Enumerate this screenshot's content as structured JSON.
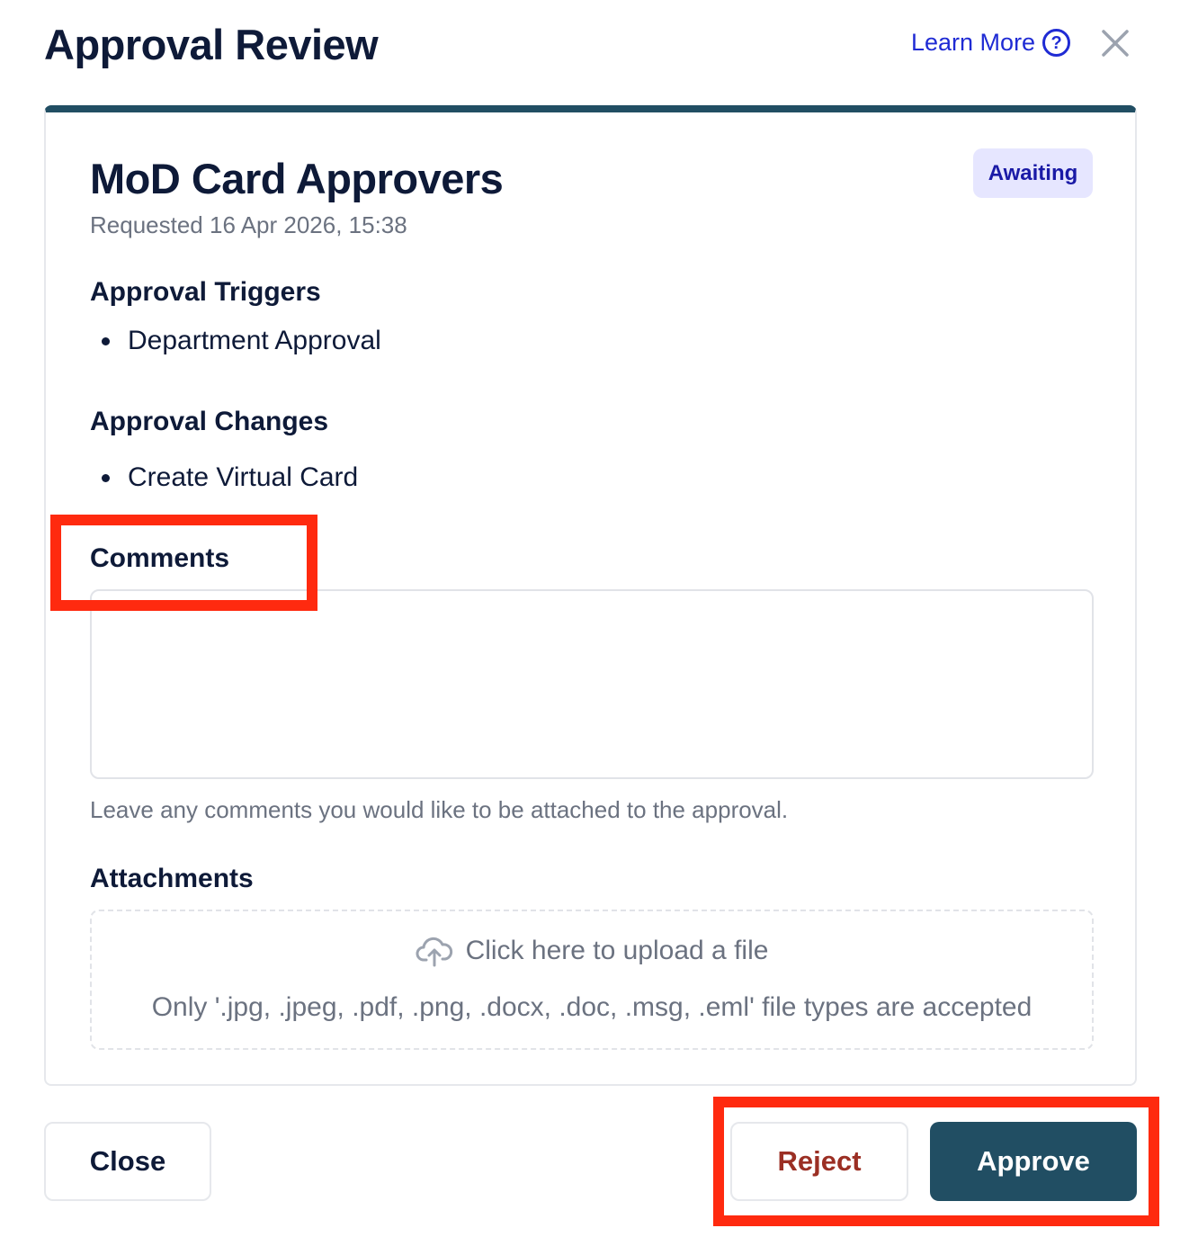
{
  "header": {
    "title": "Approval Review",
    "learn_more": "Learn More",
    "help_icon_glyph": "?"
  },
  "card": {
    "title": "MoD Card Approvers",
    "requested": "Requested 16 Apr 2026, 15:38",
    "status_badge": "Awaiting",
    "triggers": {
      "heading": "Approval Triggers",
      "items": [
        "Department Approval"
      ]
    },
    "changes": {
      "heading": "Approval Changes",
      "items": [
        "Create Virtual Card"
      ]
    },
    "comments": {
      "heading": "Comments",
      "value": "",
      "helper": "Leave any comments you would like to be attached to the approval."
    },
    "attachments": {
      "heading": "Attachments",
      "upload_text": "Click here to upload a file",
      "accepted_types": "Only '.jpg, .jpeg, .pdf, .png, .docx, .doc, .msg, .eml' file types are accepted"
    }
  },
  "footer": {
    "close_label": "Close",
    "reject_label": "Reject",
    "approve_label": "Approve"
  },
  "colors": {
    "accent": "#214e63",
    "link": "#1f2bd4",
    "reject": "#9b2f24",
    "highlight": "#ff2a0f",
    "badge_bg": "#e6e6ff"
  },
  "icons": [
    "help-circle-icon",
    "close-icon",
    "cloud-upload-icon"
  ]
}
